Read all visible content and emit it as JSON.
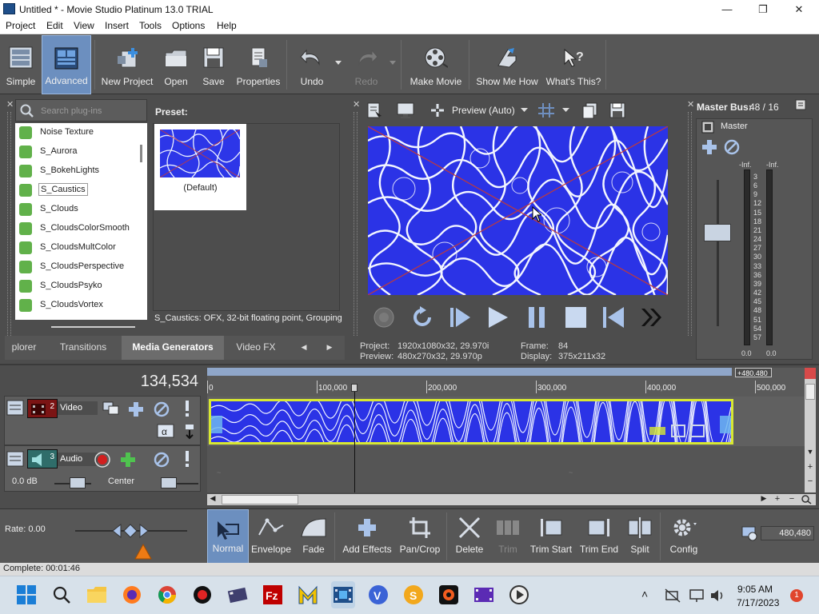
{
  "window": {
    "title": "Untitled * - Movie Studio Platinum 13.0 TRIAL",
    "minimize": "—",
    "maximize": "❐",
    "close": "✕"
  },
  "menu": [
    "Project",
    "Edit",
    "View",
    "Insert",
    "Tools",
    "Options",
    "Help"
  ],
  "toolbar": {
    "simple": "Simple",
    "advanced": "Advanced",
    "new_project": "New Project",
    "open": "Open",
    "save": "Save",
    "properties": "Properties",
    "undo": "Undo",
    "redo": "Redo",
    "make_movie": "Make Movie",
    "show_me_how": "Show Me How",
    "whats_this": "What's This?"
  },
  "plugins": {
    "search_placeholder": "Search plug-ins",
    "items": [
      "Noise Texture",
      "S_Aurora",
      "S_BokehLights",
      "S_Caustics",
      "S_Clouds",
      "S_CloudsColorSmooth",
      "S_CloudsMultColor",
      "S_CloudsPerspective",
      "S_CloudsPsyko",
      "S_CloudsVortex"
    ],
    "selected_index": 3,
    "preset_label": "Preset:",
    "preset_name": "(Default)",
    "description": "S_Caustics: OFX, 32-bit floating point, Grouping"
  },
  "tabs": {
    "explorer": "plorer",
    "transitions": "Transitions",
    "media_generators": "Media Generators",
    "video_fx": "Video FX",
    "prev_arrow": "◀",
    "next_arrow": "▶"
  },
  "preview": {
    "mode": "Preview (Auto)",
    "project_label": "Project:",
    "project_value": "1920x1080x32, 29.970i",
    "preview_label": "Preview:",
    "preview_value": "480x270x32, 29.970p",
    "frame_label": "Frame:",
    "frame_value": "84",
    "display_label": "Display:",
    "display_value": "375x211x32"
  },
  "master": {
    "title": "Master Bus:",
    "value": "48 / 16",
    "name": "Master",
    "left_inf": "-Inf.",
    "right_inf": "-Inf.",
    "scale": [
      "3",
      "6",
      "9",
      "12",
      "15",
      "18",
      "21",
      "24",
      "27",
      "30",
      "33",
      "36",
      "39",
      "42",
      "45",
      "48",
      "51",
      "54",
      "57"
    ],
    "left_val": "0.0",
    "right_val": "0.0"
  },
  "timeline": {
    "timecode": "134,534",
    "marker_end": "+480.480",
    "ruler": [
      "0",
      "100,000",
      "200,000",
      "300,000",
      "400,000",
      "500,000"
    ],
    "video_track": {
      "number": "2",
      "name": "Video"
    },
    "audio_track": {
      "number": "3",
      "name": "Audio",
      "volume": "0.0 dB",
      "pan": "Center"
    },
    "playhead_fraction": 0.265
  },
  "bottombar": {
    "rate": "Rate: 0.00",
    "normal": "Normal",
    "envelope": "Envelope",
    "fade": "Fade",
    "add_effects": "Add Effects",
    "pan_crop": "Pan/Crop",
    "delete": "Delete",
    "trim": "Trim",
    "trim_start": "Trim Start",
    "trim_end": "Trim End",
    "split": "Split",
    "config": "Config",
    "length": "480,480"
  },
  "status": "Complete: 00:01:46",
  "taskbar": {
    "time": "9:05 AM",
    "date": "7/17/2023",
    "notification_count": "1",
    "chevron": "˄"
  },
  "colors": {
    "accent": "#6c8fbf",
    "clip_border": "#d8e832",
    "water": "#2b33e6"
  }
}
